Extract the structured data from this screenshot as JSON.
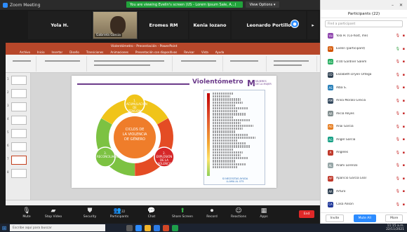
{
  "zoom": {
    "window_title": "Zoom Meeting",
    "banner_text": "You are viewing Evelin's screen (US - Lorem Ipsum Sale, A...)",
    "view_options": "View Options ▾"
  },
  "gallery": [
    {
      "label": "Yola H.",
      "type": "name"
    },
    {
      "label": "Gabriela Garcia",
      "type": "video"
    },
    {
      "label": "Eromes RM",
      "type": "name"
    },
    {
      "label": "Kenia Iozano",
      "type": "name"
    },
    {
      "label": "Leonardo Portillo",
      "type": "name"
    }
  ],
  "ppt": {
    "title": "Violentómetro - Presentación - PowerPoint",
    "menu": [
      "Archivo",
      "Inicio",
      "Insertar",
      "Diseño",
      "Transiciones",
      "Animaciones",
      "Presentación con diapositivas",
      "Revisar",
      "Vista",
      "Ayuda"
    ],
    "thumbs": [
      "1",
      "2",
      "3",
      "4",
      "5",
      "6",
      "7",
      "8"
    ]
  },
  "slide": {
    "title": "Violentómetro",
    "logo_text": "MUJERES\nDE LA MUJER",
    "center_label": "CICLOS DE\nLA VIOLENCIA\nDE GÉNERO",
    "segments": [
      "1. ACUMULACIÓN DE TENSIÓN",
      "2. EXPLOSIÓN DE LA VIOLENCIA",
      "3. RECONCILIACIÓN"
    ],
    "meter_footer": "SI NECESITAS AYUDA\nLLAMA AL 075"
  },
  "panel": {
    "header": "Participants (22)",
    "search_placeholder": "Find a participant",
    "participants": [
      {
        "name": "Yola H. (Co-host, me)",
        "initials": "YH",
        "color": "#8e44ad"
      },
      {
        "name": "Evelin (participant)",
        "initials": "EV",
        "color": "#d35400"
      },
      {
        "name": "4:00 Gardner Salem",
        "initials": "4G",
        "color": "#27ae60"
      },
      {
        "name": "Elizabeth Dryen Ortega",
        "initials": "ED",
        "color": "#2c3e50"
      },
      {
        "name": "Alba S.",
        "initials": "AS",
        "color": "#2980b9"
      },
      {
        "name": "Anna Moralo Grecia",
        "initials": "AM",
        "color": "#34495e"
      },
      {
        "name": "Alicia Reyes",
        "initials": "AR",
        "color": "#7f8c8d"
      },
      {
        "name": "Anai Garcia",
        "initials": "AG",
        "color": "#e67e22"
      },
      {
        "name": "Angel Garcia",
        "initials": "AG",
        "color": "#16a085"
      },
      {
        "name": "Angeles",
        "initials": "A",
        "color": "#c0392b"
      },
      {
        "name": "Anahi Lorenzo",
        "initials": "AL",
        "color": "#95a5a6"
      },
      {
        "name": "Aparicio Garcia Leal",
        "initials": "AP",
        "color": "#c0392b"
      },
      {
        "name": "Arturo",
        "initials": "AR",
        "color": "#2c3e50"
      },
      {
        "name": "Casa Alison",
        "initials": "CA",
        "color": "#1e3799"
      }
    ],
    "btn_invite": "Invite",
    "btn_mute_all": "Mute All",
    "btn_more": "More"
  },
  "toolbar": {
    "items": [
      "Mute",
      "Stop Video",
      "Security",
      "Participants",
      "Chat",
      "Share Screen",
      "Record",
      "Reactions",
      "Apps"
    ],
    "participants_count": "22",
    "end": "End"
  },
  "taskbar": {
    "search": "Escribe aquí para buscar",
    "time": "11:15 a.m.",
    "date": "22/11/2021"
  }
}
